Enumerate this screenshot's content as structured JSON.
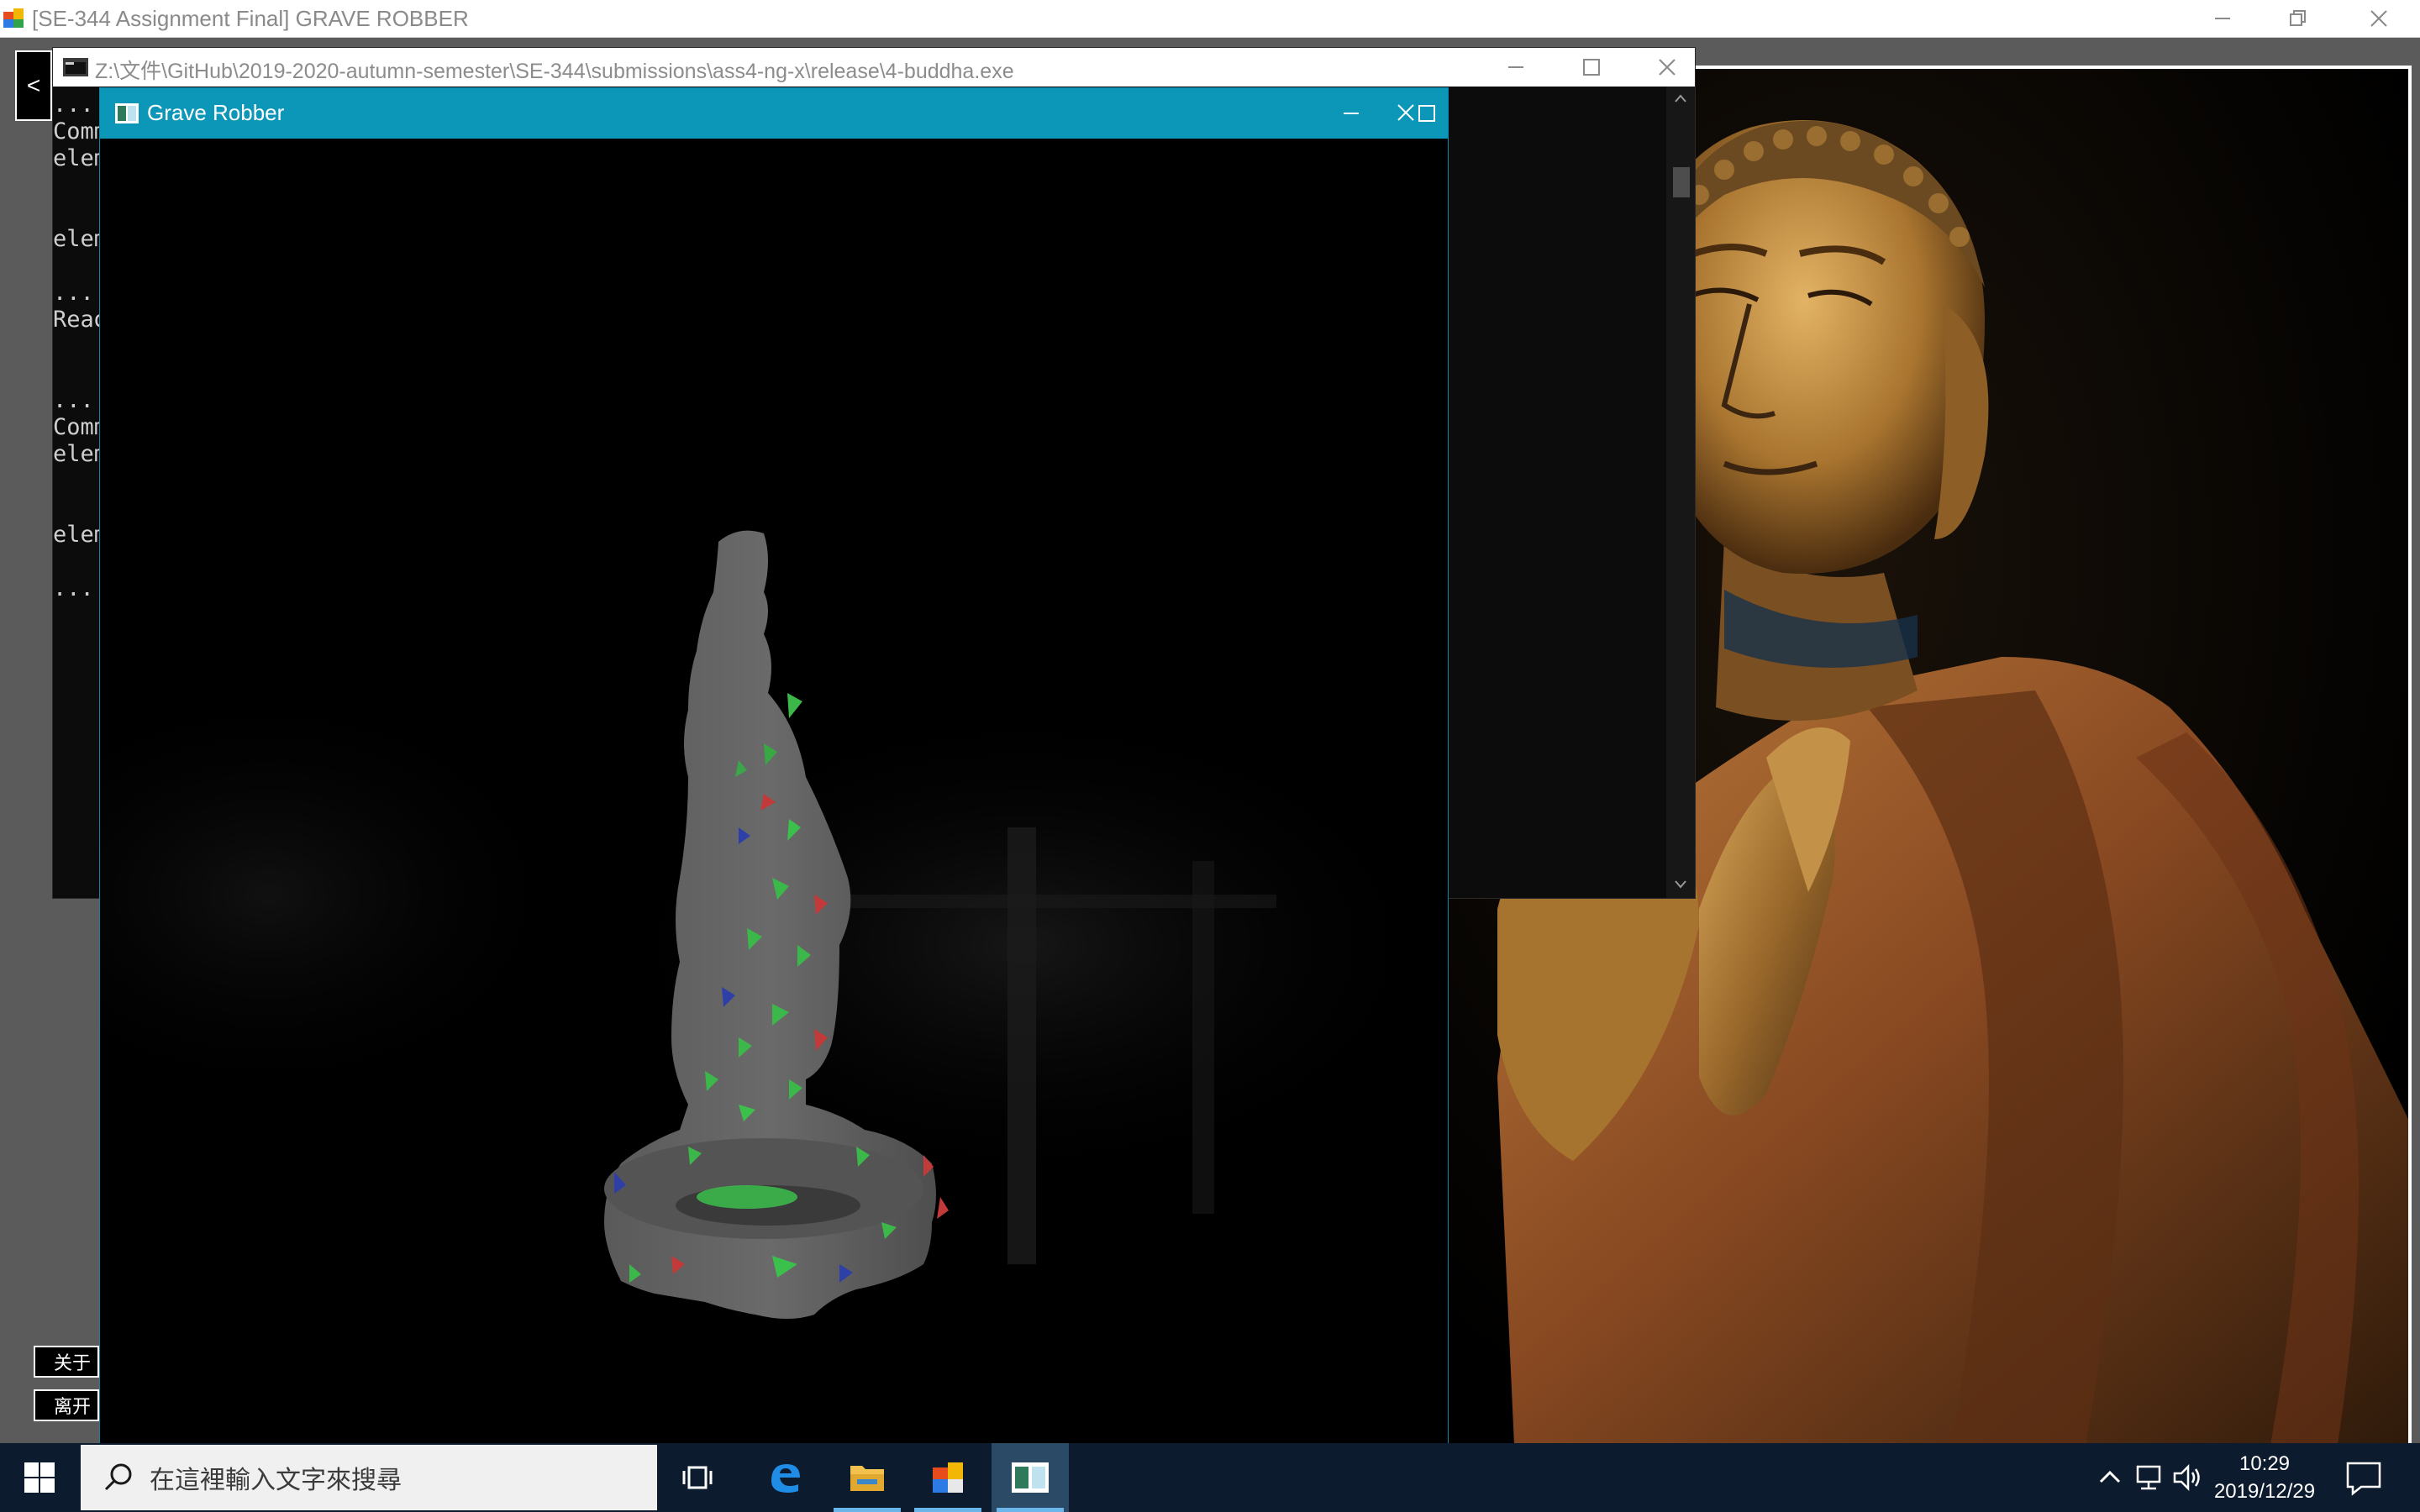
{
  "main_window": {
    "title": "[SE-344 Assignment Final] GRAVE ROBBER"
  },
  "side_panel": {
    "back_label": "<",
    "about_label": "关于",
    "leave_label": "离开"
  },
  "console_window": {
    "title": "Z:\\文件\\GitHub\\2019-2020-autumn-semester\\SE-344\\submissions\\ass4-ng-x\\release\\4-buddha.exe",
    "lines": [
      "....",
      "Comm",
      "elem",
      "",
      "",
      "elem",
      "",
      "....",
      "Read",
      "",
      "",
      "....",
      "Comm",
      "elem",
      "",
      "",
      "elem",
      "",
      "...."
    ]
  },
  "gl_window": {
    "title": "Grave Robber"
  },
  "taskbar": {
    "search_placeholder": "在這裡輸入文字來搜尋",
    "apps": [
      "task-view",
      "edge",
      "file-explorer",
      "paint",
      "grave-robber"
    ],
    "active_app": "grave-robber",
    "time": "10:29",
    "date": "2019/12/29"
  },
  "colors": {
    "gl_title_bar": "#0c96b8",
    "taskbar": "#0c1c2e",
    "desktop": "#5b5b5b"
  }
}
